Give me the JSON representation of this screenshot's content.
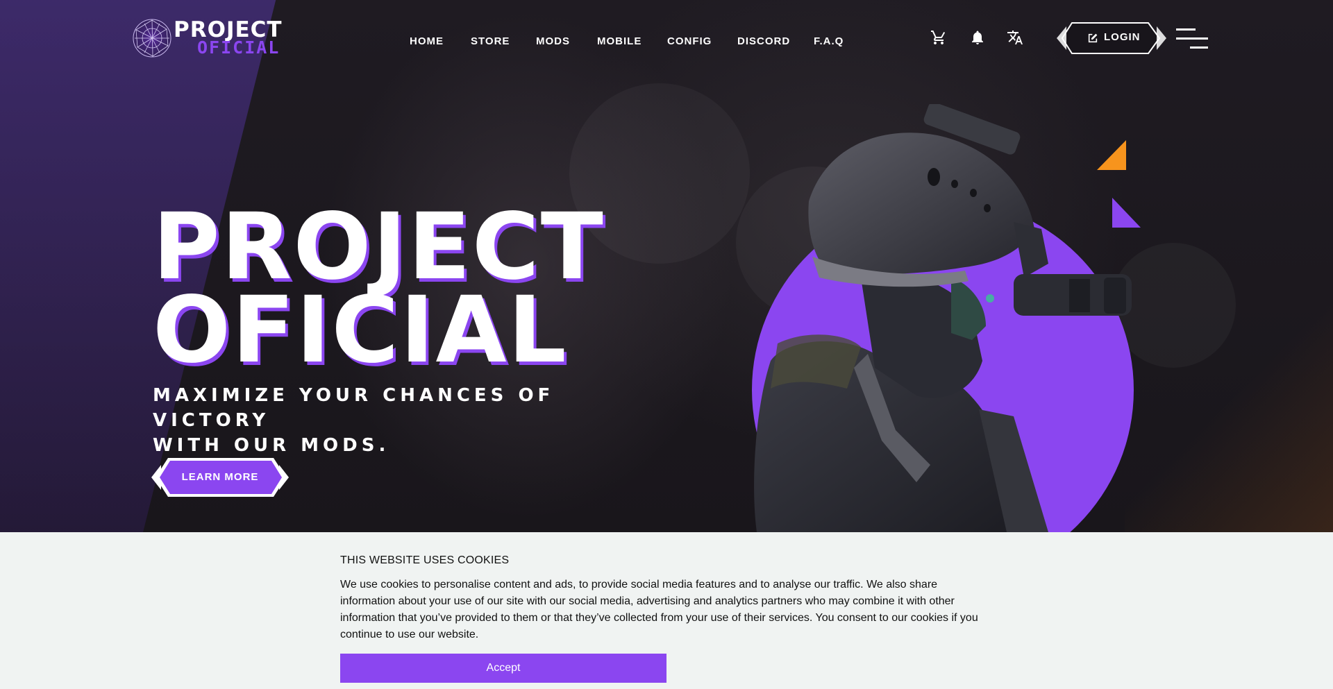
{
  "brand": {
    "name_line1": "PROJECT",
    "name_line2": "OFICIAL",
    "accent_color": "#8b46f0",
    "logo_icon": "wireframe-globe-icon"
  },
  "nav": {
    "items": [
      {
        "label": "HOME"
      },
      {
        "label": "STORE"
      },
      {
        "label": "MODS"
      },
      {
        "label": "MOBILE"
      },
      {
        "label": "CONFIG"
      },
      {
        "label": "DISCORD"
      },
      {
        "label": "F.A.Q"
      }
    ],
    "icons": [
      "cart-icon",
      "bell-icon",
      "translate-icon"
    ],
    "login_label": "LOGIN",
    "login_icon": "edit-icon",
    "menu_icon": "hamburger-menu-icon"
  },
  "hero": {
    "title_line1": "PROJECT",
    "title_line2": "OFICIAL",
    "subtitle_line1": "MAXIMIZE YOUR CHANCES OF VICTORY",
    "subtitle_line2": "WITH OUR MODS.",
    "cta_label": "LEARN MORE",
    "decor_colors": {
      "orange": "#f7941d",
      "purple": "#8b46f0"
    }
  },
  "cookie_banner": {
    "title": "THIS WEBSITE USES COOKIES",
    "text": "We use cookies to personalise content and ads, to provide social media features and to analyse our traffic. We also share information about your use of our site with our social media, advertising and analytics partners who may combine it with other information that you’ve provided to them or that they’ve collected from your use of their services. You consent to our cookies if you continue to use our website.",
    "accept_label": "Accept",
    "background": "#f0f3f2"
  }
}
